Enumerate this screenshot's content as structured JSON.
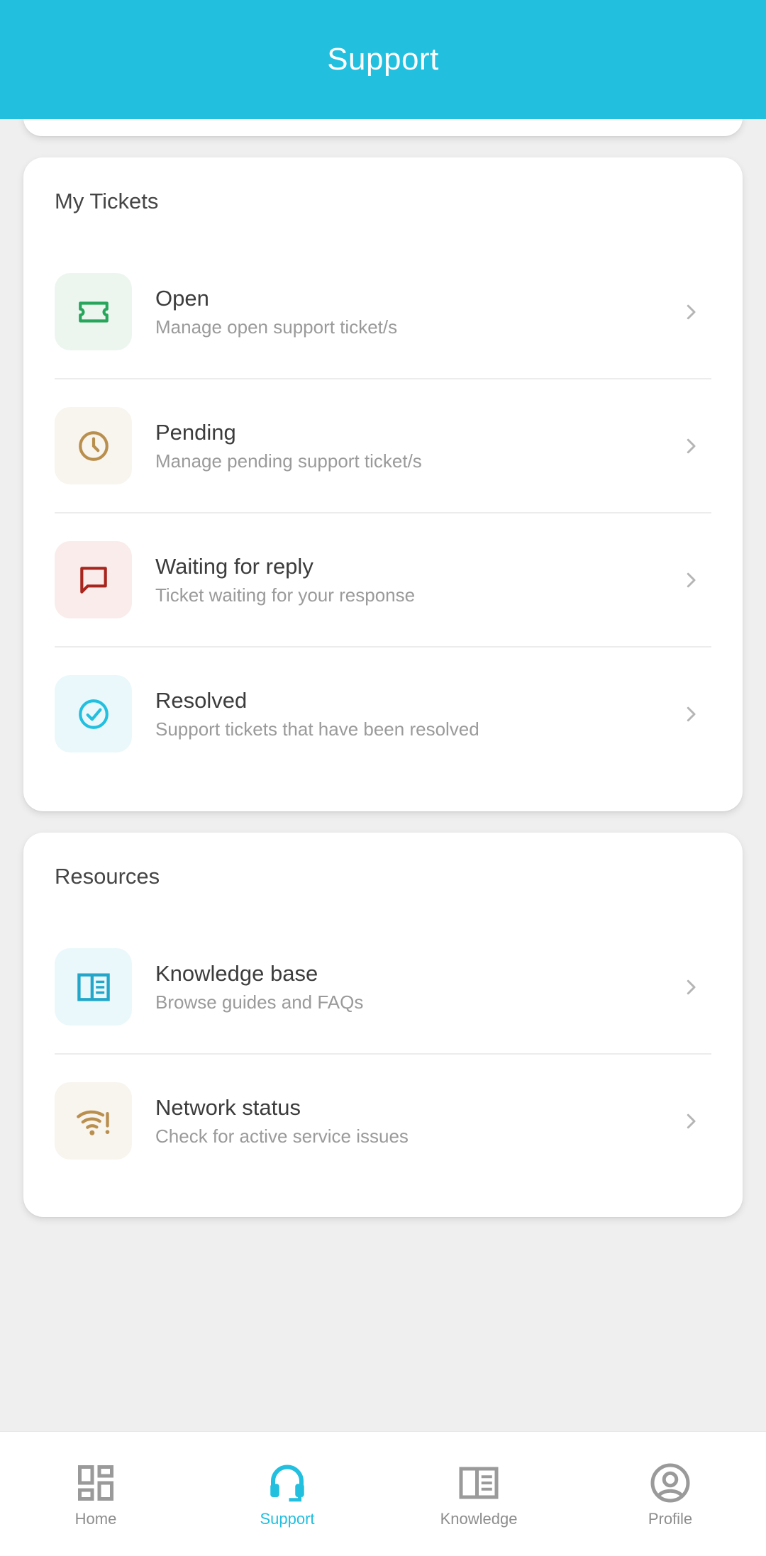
{
  "header": {
    "title": "Support"
  },
  "colors": {
    "accent": "#22bfdf",
    "open": "#27a65b",
    "pending": "#b98f4e",
    "waiting": "#a8251e",
    "resolved": "#22bfdf"
  },
  "tickets": {
    "title": "My Tickets",
    "items": [
      {
        "title": "Open",
        "subtitle": "Manage open support ticket/s",
        "icon": "ticket-icon"
      },
      {
        "title": "Pending",
        "subtitle": "Manage pending support ticket/s",
        "icon": "clock-icon"
      },
      {
        "title": "Waiting for reply",
        "subtitle": "Ticket waiting for your response",
        "icon": "chat-bubble-icon"
      },
      {
        "title": "Resolved",
        "subtitle": "Support tickets that have been resolved",
        "icon": "check-circle-icon"
      }
    ]
  },
  "resources": {
    "title": "Resources",
    "items": [
      {
        "title": "Knowledge base",
        "subtitle": "Browse guides and FAQs",
        "icon": "book-icon"
      },
      {
        "title": "Network status",
        "subtitle": "Check for active service issues",
        "icon": "wifi-alert-icon"
      }
    ]
  },
  "bottom_nav": {
    "items": [
      {
        "label": "Home",
        "icon": "dashboard-icon",
        "active": false
      },
      {
        "label": "Support",
        "icon": "headset-icon",
        "active": true
      },
      {
        "label": "Knowledge",
        "icon": "book-icon",
        "active": false
      },
      {
        "label": "Profile",
        "icon": "user-circle-icon",
        "active": false
      }
    ]
  }
}
